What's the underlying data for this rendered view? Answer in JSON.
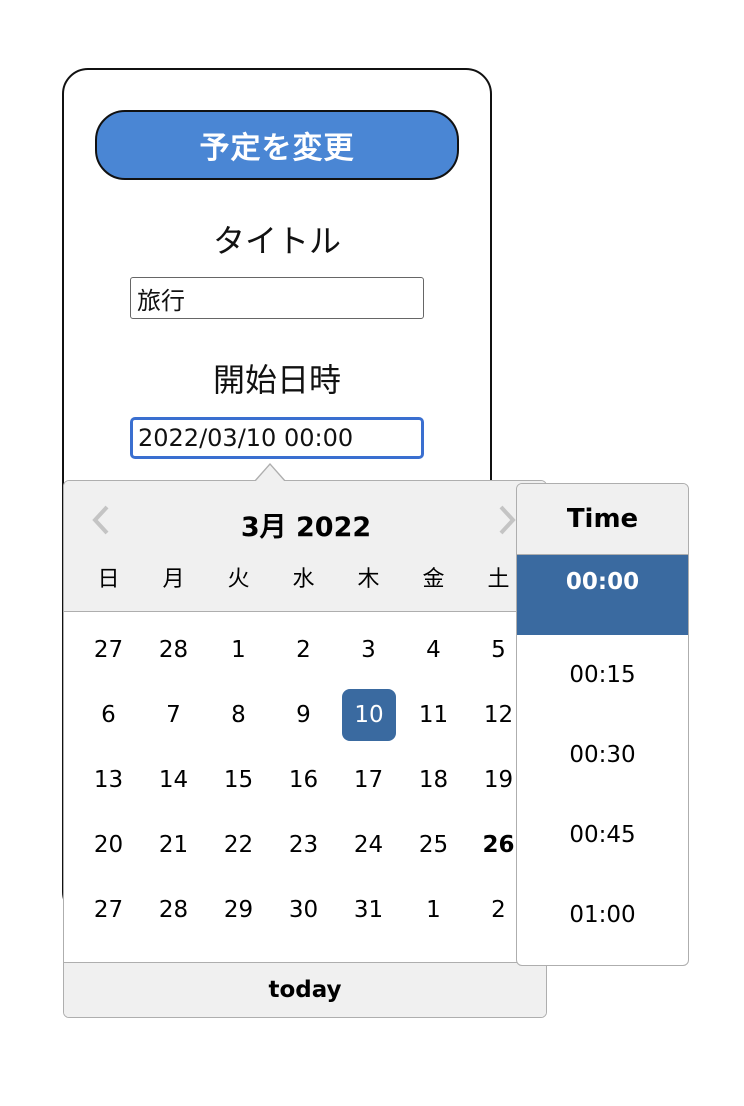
{
  "form": {
    "change_button": "予定を変更",
    "title_label": "タイトル",
    "title_value": "旅行",
    "start_label": "開始日時",
    "start_value": "2022/03/10 00:00"
  },
  "datepicker": {
    "month_title": "3月 2022",
    "weekdays": [
      "日",
      "月",
      "火",
      "水",
      "木",
      "金",
      "土"
    ],
    "weeks": [
      [
        "27",
        "28",
        "1",
        "2",
        "3",
        "4",
        "5"
      ],
      [
        "6",
        "7",
        "8",
        "9",
        "10",
        "11",
        "12"
      ],
      [
        "13",
        "14",
        "15",
        "16",
        "17",
        "18",
        "19"
      ],
      [
        "20",
        "21",
        "22",
        "23",
        "24",
        "25",
        "26"
      ],
      [
        "27",
        "28",
        "29",
        "30",
        "31",
        "1",
        "2"
      ]
    ],
    "selected_day": "10",
    "today_day": "26",
    "today_button": "today",
    "prev_icon": "chevron-left-icon",
    "next_icon": "chevron-right-icon"
  },
  "timepicker": {
    "header": "Time",
    "times": [
      "00:00",
      "00:15",
      "00:30",
      "00:45",
      "01:00"
    ],
    "selected_time": "00:00"
  },
  "colors": {
    "button_bg": "#4a86d4",
    "selected_bg": "#3a6aa0",
    "focus_border": "#3a6fd0",
    "header_bg": "#f0f0f0"
  }
}
